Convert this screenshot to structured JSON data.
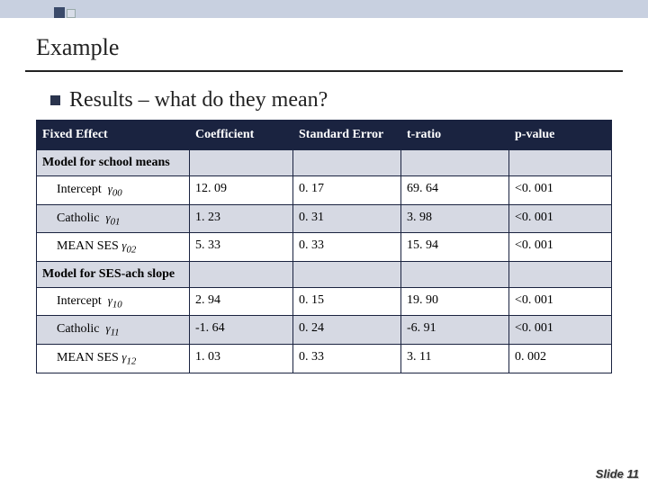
{
  "title": "Example",
  "subtitle": "Results – what do they mean?",
  "headers": {
    "fixed": "Fixed Effect",
    "coef": "Coefficient",
    "se": "Standard Error",
    "t": "t-ratio",
    "p": "p-value"
  },
  "section1": "Model for school means",
  "section2": "Model for SES-ach slope",
  "sym": {
    "g00": "γ",
    "s00": "00",
    "g01": "γ",
    "s01": "01",
    "g02": "γ",
    "s02": "02",
    "g10": "γ",
    "s10": "10",
    "g11": "γ",
    "s11": "11",
    "g12": "γ",
    "s12": "12"
  },
  "rows1": {
    "intercept": {
      "label": "Intercept",
      "coef": "12. 09",
      "se": "0. 17",
      "t": "69. 64",
      "p": "<0. 001"
    },
    "catholic": {
      "label": "Catholic",
      "coef": "1. 23",
      "se": "0. 31",
      "t": "3. 98",
      "p": "<0. 001"
    },
    "meanses": {
      "label": "MEAN SES",
      "coef": "5. 33",
      "se": "0. 33",
      "t": "15. 94",
      "p": "<0. 001"
    }
  },
  "rows2": {
    "intercept": {
      "label": "Intercept",
      "coef": "2. 94",
      "se": "0. 15",
      "t": "19. 90",
      "p": "<0. 001"
    },
    "catholic": {
      "label": "Catholic",
      "coef": "-1. 64",
      "se": "0. 24",
      "t": "-6. 91",
      "p": "<0. 001"
    },
    "meanses": {
      "label": "MEAN SES",
      "coef": "1. 03",
      "se": "0. 33",
      "t": "3. 11",
      "p": "0. 002"
    }
  },
  "footer": {
    "label": "Slide",
    "num": "11"
  },
  "chart_data": {
    "type": "table",
    "title": "Fixed Effects Results",
    "columns": [
      "Fixed Effect",
      "Coefficient",
      "Standard Error",
      "t-ratio",
      "p-value"
    ],
    "sections": [
      {
        "name": "Model for school means",
        "rows": [
          {
            "effect": "Intercept (γ00)",
            "coefficient": 12.09,
            "se": 0.17,
            "t": 69.64,
            "p": "<0.001"
          },
          {
            "effect": "Catholic (γ01)",
            "coefficient": 1.23,
            "se": 0.31,
            "t": 3.98,
            "p": "<0.001"
          },
          {
            "effect": "MEAN SES (γ02)",
            "coefficient": 5.33,
            "se": 0.33,
            "t": 15.94,
            "p": "<0.001"
          }
        ]
      },
      {
        "name": "Model for SES-ach slope",
        "rows": [
          {
            "effect": "Intercept (γ10)",
            "coefficient": 2.94,
            "se": 0.15,
            "t": 19.9,
            "p": "<0.001"
          },
          {
            "effect": "Catholic (γ11)",
            "coefficient": -1.64,
            "se": 0.24,
            "t": -6.91,
            "p": "<0.001"
          },
          {
            "effect": "MEAN SES (γ12)",
            "coefficient": 1.03,
            "se": 0.33,
            "t": 3.11,
            "p": "0.002"
          }
        ]
      }
    ]
  }
}
